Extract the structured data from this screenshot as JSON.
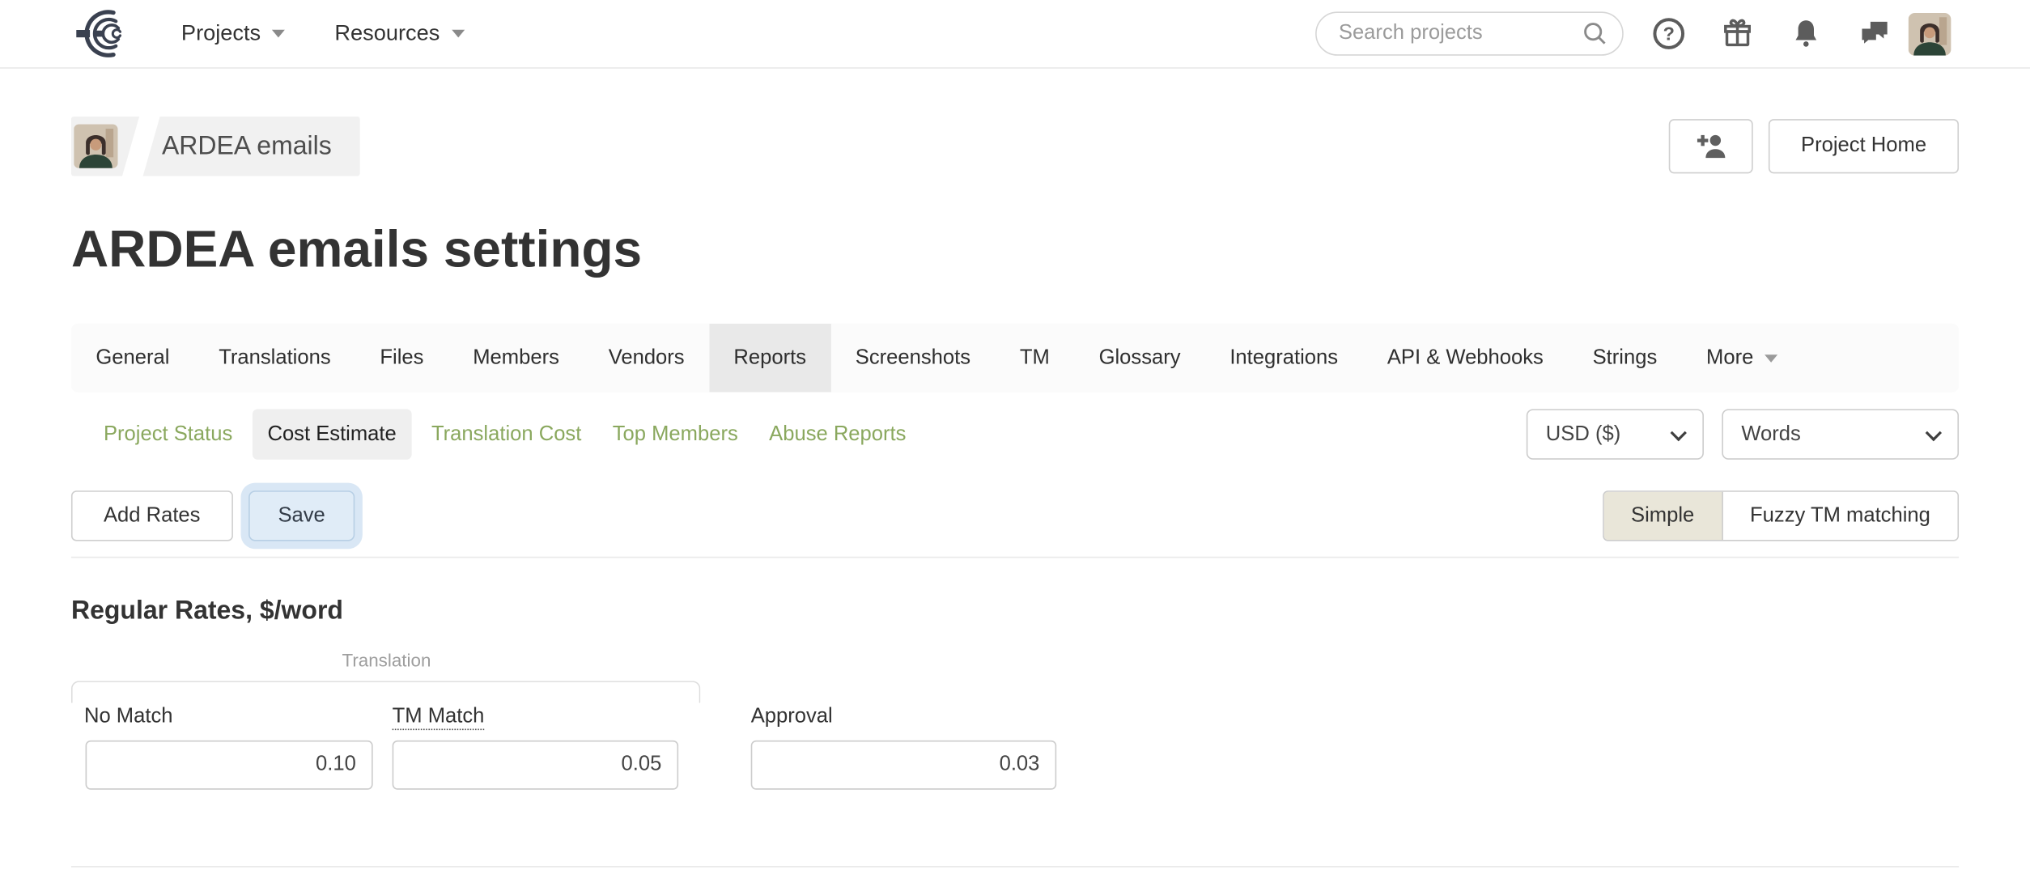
{
  "topnav": {
    "menus": [
      {
        "label": "Projects"
      },
      {
        "label": "Resources"
      }
    ],
    "search_placeholder": "Search projects",
    "icon_names": [
      "search-icon",
      "help-icon",
      "gift-icon",
      "bell-icon",
      "chat-icon",
      "user-avatar"
    ]
  },
  "breadcrumb": {
    "project_name": "ARDEA emails"
  },
  "header_actions": {
    "invite_icon": "add-member-icon",
    "project_home_label": "Project Home"
  },
  "page": {
    "title": "ARDEA emails settings"
  },
  "tabs": {
    "items": [
      "General",
      "Translations",
      "Files",
      "Members",
      "Vendors",
      "Reports",
      "Screenshots",
      "TM",
      "Glossary",
      "Integrations",
      "API & Webhooks",
      "Strings",
      "More"
    ],
    "active": "Reports"
  },
  "subtabs": {
    "items": [
      "Project Status",
      "Cost Estimate",
      "Translation Cost",
      "Top Members",
      "Abuse Reports"
    ],
    "active": "Cost Estimate"
  },
  "filters": {
    "currency": "USD ($)",
    "unit": "Words"
  },
  "toolbar": {
    "add_rates_label": "Add Rates",
    "save_label": "Save"
  },
  "mode_toggle": {
    "options": [
      "Simple",
      "Fuzzy TM matching"
    ],
    "active": "Simple"
  },
  "rates": {
    "heading": "Regular Rates, $/word",
    "group_label": "Translation",
    "columns": [
      {
        "label": "No Match",
        "value": "0.10"
      },
      {
        "label": "TM Match",
        "value": "0.05"
      },
      {
        "label": "Approval",
        "value": "0.03"
      }
    ]
  },
  "colors": {
    "link_green": "#8aa85e",
    "active_tab_bg": "#e9e9e9",
    "active_subtab_bg": "#efefef",
    "save_button_bg": "#e0ecf7",
    "save_focus_ring": "#d9e7f5",
    "simple_active_bg": "#e9e6d9",
    "breadcrumb_bg": "#f1f1f1"
  }
}
